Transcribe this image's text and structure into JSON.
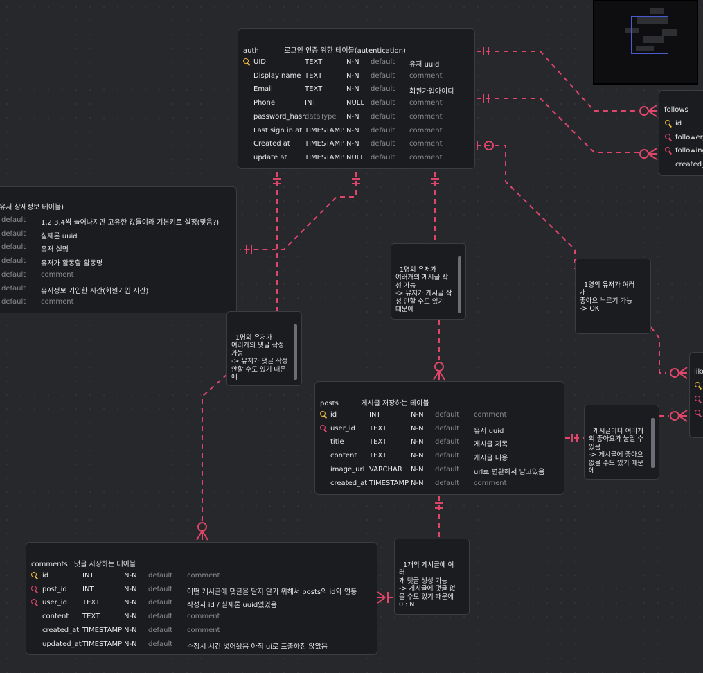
{
  "colors": {
    "background": "#27282c",
    "relation": "#e0466a",
    "pk": "#e9b640",
    "fk": "#e0466a",
    "card": "#1b1c1f"
  },
  "tables": {
    "auth": {
      "name": "auth",
      "comment": "로그인 인증 위한 테이블(autentication)",
      "rows": [
        {
          "key": "pk",
          "name": "UID",
          "type": "TEXT",
          "nn": "N-N",
          "def": "default",
          "note": "유저 uuid"
        },
        {
          "key": "",
          "name": "Display name",
          "type": "TEXT",
          "nn": "N-N",
          "def": "default",
          "note": "comment"
        },
        {
          "key": "",
          "name": "Email",
          "type": "TEXT",
          "nn": "N-N",
          "def": "default",
          "note": "회원가입아이디"
        },
        {
          "key": "",
          "name": "Phone",
          "type": "INT",
          "nn": "NULL",
          "def": "default",
          "note": "comment"
        },
        {
          "key": "",
          "name": "password_hash",
          "type": "dataType",
          "nn": "N-N",
          "def": "default",
          "note": "comment"
        },
        {
          "key": "",
          "name": "Last sign in at",
          "type": "TIMESTAMP",
          "nn": "N-N",
          "def": "default",
          "note": "comment"
        },
        {
          "key": "",
          "name": "Created at",
          "type": "TIMESTAMP",
          "nn": "N-N",
          "def": "default",
          "note": "comment"
        },
        {
          "key": "",
          "name": "update at",
          "type": "TIMESTAMP",
          "nn": "NULL",
          "def": "default",
          "note": "comment"
        }
      ]
    },
    "profile": {
      "comment": "유저 상세정보 테이블)",
      "rows": [
        {
          "def": "default",
          "note": "1,2,3,4씩 늘어나지만 고유한 값들이라 기본키로 설정(맞음?)"
        },
        {
          "def": "default",
          "note": "실제론 uuid"
        },
        {
          "def": "default",
          "note": "유저 설명"
        },
        {
          "def": "default",
          "note": "유저가 활동할 활동명"
        },
        {
          "def": "default",
          "note": "comment"
        },
        {
          "def": "default",
          "note": "유저정보 기입한 시간(회원가입 시간)"
        },
        {
          "def": "default",
          "note": "comment"
        }
      ]
    },
    "follows": {
      "name": "follows",
      "rows": [
        {
          "key": "pk",
          "name": "id"
        },
        {
          "key": "fk",
          "name": "follower_"
        },
        {
          "key": "fk",
          "name": "following"
        },
        {
          "key": "",
          "name": "created_a"
        }
      ]
    },
    "likes": {
      "name": "like",
      "rows": [
        {
          "key": "pk"
        },
        {
          "key": "fk"
        },
        {
          "key": "fk"
        }
      ]
    },
    "posts": {
      "name": "posts",
      "comment": "게시글 저장하는 테이블",
      "rows": [
        {
          "key": "pk",
          "name": "id",
          "type": "INT",
          "nn": "N-N",
          "def": "default",
          "note": "comment"
        },
        {
          "key": "fk",
          "name": "user_id",
          "type": "TEXT",
          "nn": "N-N",
          "def": "default",
          "note": "유저 uuid"
        },
        {
          "key": "",
          "name": "title",
          "type": "TEXT",
          "nn": "N-N",
          "def": "default",
          "note": "게시글 제목"
        },
        {
          "key": "",
          "name": "content",
          "type": "TEXT",
          "nn": "N-N",
          "def": "default",
          "note": "게시글 내용"
        },
        {
          "key": "",
          "name": "image_url",
          "type": "VARCHAR",
          "nn": "N-N",
          "def": "default",
          "note": "url로 변환해서 담고있음"
        },
        {
          "key": "",
          "name": "created_at",
          "type": "TIMESTAMP",
          "nn": "N-N",
          "def": "default",
          "note": "comment"
        }
      ]
    },
    "comments": {
      "name": "comments",
      "comment": "댓글 저장하는 테이블",
      "rows": [
        {
          "key": "pk",
          "name": "id",
          "type": "INT",
          "nn": "N-N",
          "def": "default",
          "note": "comment"
        },
        {
          "key": "fk",
          "name": "post_id",
          "type": "INT",
          "nn": "N-N",
          "def": "default",
          "note": "어떤 게시글에 댓글을 달지 알기 위해서 posts의 id와 연동"
        },
        {
          "key": "fk",
          "name": "user_id",
          "type": "TEXT",
          "nn": "N-N",
          "def": "default",
          "note": "작성자 id / 실제론 uuid였었음"
        },
        {
          "key": "",
          "name": "content",
          "type": "TEXT",
          "nn": "N-N",
          "def": "default",
          "note": "comment"
        },
        {
          "key": "",
          "name": "created_at",
          "type": "TIMESTAMP",
          "nn": "N-N",
          "def": "default",
          "note": "comment"
        },
        {
          "key": "",
          "name": "updated_at",
          "type": "TIMESTAMP",
          "nn": "N-N",
          "def": "default",
          "note": "수정시 시간 넣어놨음 아직 ui로 표출하진 않았음"
        }
      ]
    }
  },
  "notes": {
    "posts_note": "1명의 유저가\n여러개의 게시글 작\n성 가능\n-> 유저가 게시글 작\n성 안할 수도 있기\n때문에",
    "likes_note": "1명의 유저가 여러개\n좋아요 누르기 가능\n-> OK",
    "comments_note": "1명의 유저가\n여러개의 댓글 작성\n가능\n-> 유저가 댓글 작성\n안할 수도 있기 때문\n에",
    "post_likes_note": "게시글마다 여러개\n의 좋아요가 눌릴 수\n있음\n-> 게시글에 좋아요\n없을 수도 있기 때문\n에",
    "post_comments_note": "1개의 게시글에 여러\n개 댓글 생성 가능\n-> 게시글에 댓글 없\n을 수도 있기 때문에\n0 : N"
  }
}
